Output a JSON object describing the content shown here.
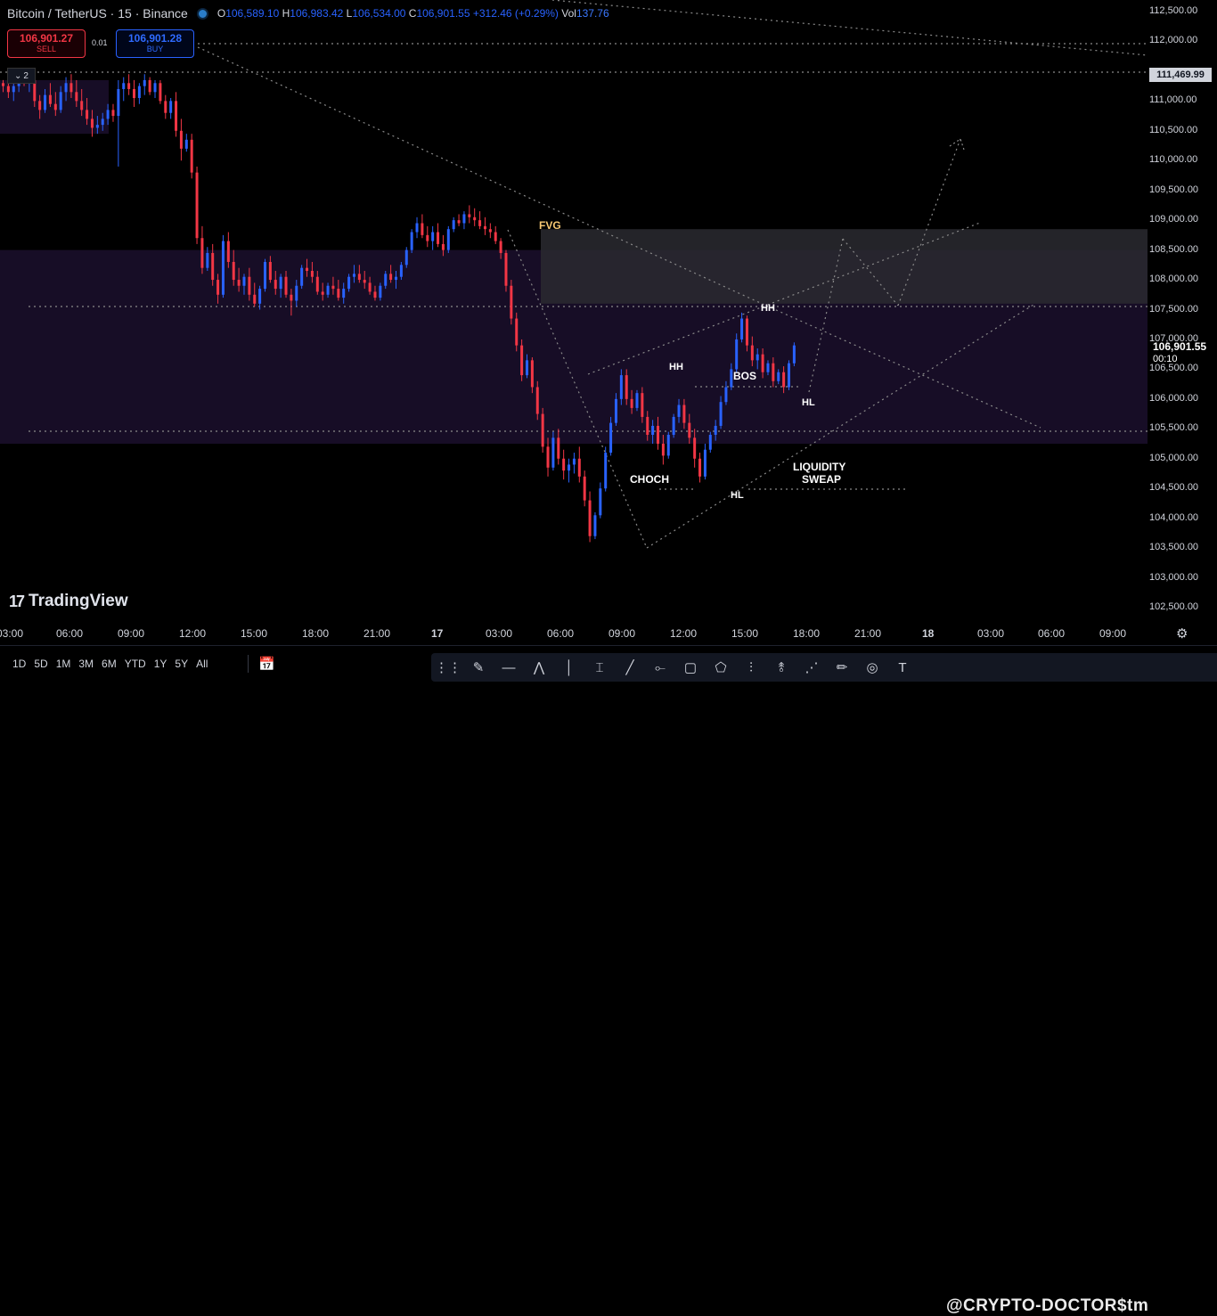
{
  "header": {
    "symbol": "Bitcoin / TetherUS · 15 · Binance",
    "open_label": "O",
    "open": "106,589.10",
    "high_label": "H",
    "high": "106,983.42",
    "low_label": "L",
    "low": "106,534.00",
    "close_label": "C",
    "close": "106,901.55",
    "change": "+312.46 (+0.29%)",
    "vol_label": "Vol",
    "vol": "137.76"
  },
  "trade": {
    "sell_price": "106,901.27",
    "sell_label": "SELL",
    "spread": "0.01",
    "buy_price": "106,901.28",
    "buy_label": "BUY"
  },
  "layers_count": "2",
  "logo": "TradingView",
  "price_axis": {
    "ticks": [
      "112,500.00",
      "112,000.00",
      "111,000.00",
      "110,500.00",
      "110,000.00",
      "109,500.00",
      "109,000.00",
      "108,500.00",
      "108,000.00",
      "107,500.00",
      "107,000.00",
      "106,500.00",
      "106,000.00",
      "105,500.00",
      "105,000.00",
      "104,500.00",
      "104,000.00",
      "103,500.00",
      "103,000.00",
      "102,500.00"
    ],
    "marked": "111,469.99",
    "current": "106,901.55",
    "countdown": "00:10"
  },
  "time_axis": [
    "03:00",
    "06:00",
    "09:00",
    "12:00",
    "15:00",
    "18:00",
    "21:00",
    "17",
    "03:00",
    "06:00",
    "09:00",
    "12:00",
    "15:00",
    "18:00",
    "21:00",
    "18",
    "03:00",
    "06:00",
    "09:00"
  ],
  "annotations": {
    "fvg": "FVG",
    "hh1": "HH",
    "hh2": "HH",
    "bos": "BOS",
    "hl1": "HL",
    "hl2": "HL",
    "choch": "CHOCH",
    "liquidity": "LIQUIDITY",
    "sweap": "SWEAP"
  },
  "ranges": [
    "1D",
    "5D",
    "1M",
    "3M",
    "6M",
    "YTD",
    "1Y",
    "5Y",
    "All"
  ],
  "watermark": "@CRYPTO-DOCTOR$tm",
  "colors": {
    "up": "#2962ff",
    "down": "#f23645",
    "zone": "#170d26",
    "fvg_zone": "#2a2a30",
    "grid_dots": "#8a8a8a"
  },
  "chart_data": {
    "type": "candlestick",
    "ylim": [
      102250,
      112750
    ],
    "series": [
      {
        "values": [
          [
            111300,
            111350,
            111150,
            111250
          ],
          [
            111250,
            111400,
            111050,
            111150
          ],
          [
            111150,
            111300,
            111000,
            111250
          ],
          [
            111250,
            111500,
            111150,
            111400
          ],
          [
            111400,
            111550,
            111250,
            111300
          ],
          [
            111300,
            111450,
            111150,
            111350
          ],
          [
            111350,
            111400,
            110900,
            111000
          ],
          [
            111000,
            111100,
            110700,
            110850
          ],
          [
            110850,
            111200,
            110800,
            111100
          ],
          [
            111100,
            111300,
            110900,
            110950
          ],
          [
            110950,
            111150,
            110750,
            110850
          ],
          [
            110850,
            111250,
            110800,
            111150
          ],
          [
            111150,
            111400,
            111000,
            111300
          ],
          [
            111300,
            111450,
            111050,
            111150
          ],
          [
            111150,
            111350,
            110900,
            111000
          ],
          [
            111000,
            111200,
            110750,
            110850
          ],
          [
            110850,
            111050,
            110600,
            110700
          ],
          [
            110700,
            110850,
            110400,
            110550
          ],
          [
            110550,
            110750,
            110450,
            110600
          ],
          [
            110600,
            110800,
            110500,
            110700
          ],
          [
            110700,
            110950,
            110600,
            110850
          ],
          [
            110850,
            110950,
            110650,
            110750
          ],
          [
            110750,
            111350,
            109900,
            111200
          ],
          [
            111200,
            111400,
            111000,
            111300
          ],
          [
            111300,
            111450,
            111100,
            111200
          ],
          [
            111200,
            111350,
            110900,
            111050
          ],
          [
            111050,
            111300,
            110950,
            111250
          ],
          [
            111250,
            111450,
            111100,
            111350
          ],
          [
            111350,
            111400,
            111100,
            111150
          ],
          [
            111150,
            111350,
            111050,
            111300
          ],
          [
            111300,
            111350,
            110950,
            111000
          ],
          [
            111000,
            111100,
            110700,
            110800
          ],
          [
            110800,
            111050,
            110700,
            111000
          ],
          [
            111000,
            111150,
            110400,
            110500
          ],
          [
            110500,
            110700,
            110000,
            110200
          ],
          [
            110200,
            110450,
            110150,
            110350
          ],
          [
            110350,
            110450,
            109700,
            109800
          ],
          [
            109800,
            109900,
            108600,
            108700
          ],
          [
            108700,
            108900,
            108100,
            108200
          ],
          [
            108200,
            108550,
            108150,
            108450
          ],
          [
            108450,
            108600,
            107900,
            108000
          ],
          [
            108000,
            108100,
            107600,
            107750
          ],
          [
            107750,
            108750,
            107700,
            108650
          ],
          [
            108650,
            108800,
            108200,
            108300
          ],
          [
            108300,
            108500,
            107900,
            108000
          ],
          [
            108000,
            108200,
            107800,
            107900
          ],
          [
            107900,
            108100,
            107750,
            108050
          ],
          [
            108050,
            108200,
            107650,
            107750
          ],
          [
            107750,
            107950,
            107550,
            107600
          ],
          [
            107600,
            107900,
            107500,
            107850
          ],
          [
            107850,
            108350,
            107800,
            108300
          ],
          [
            108300,
            108400,
            107950,
            108000
          ],
          [
            108000,
            108150,
            107750,
            107850
          ],
          [
            107850,
            108100,
            107700,
            108050
          ],
          [
            108050,
            108150,
            107700,
            107750
          ],
          [
            107750,
            107850,
            107400,
            107650
          ],
          [
            107650,
            108000,
            107550,
            107900
          ],
          [
            107900,
            108250,
            107850,
            108200
          ],
          [
            108200,
            108350,
            108050,
            108150
          ],
          [
            108150,
            108300,
            107950,
            108050
          ],
          [
            108050,
            108150,
            107750,
            107800
          ],
          [
            107800,
            107950,
            107650,
            107750
          ],
          [
            107750,
            107950,
            107700,
            107900
          ],
          [
            107900,
            108050,
            107750,
            107850
          ],
          [
            107850,
            108000,
            107650,
            107700
          ],
          [
            107700,
            107950,
            107600,
            107850
          ],
          [
            107850,
            108100,
            107800,
            108050
          ],
          [
            108050,
            108250,
            107950,
            108100
          ],
          [
            108100,
            108250,
            107950,
            108000
          ],
          [
            108000,
            108150,
            107850,
            107950
          ],
          [
            107950,
            108050,
            107750,
            107800
          ],
          [
            107800,
            107900,
            107650,
            107700
          ],
          [
            107700,
            107950,
            107650,
            107900
          ],
          [
            107900,
            108150,
            107850,
            108100
          ],
          [
            108100,
            108250,
            107950,
            108000
          ],
          [
            108000,
            108150,
            107850,
            108050
          ],
          [
            108050,
            108300,
            108000,
            108250
          ],
          [
            108250,
            108550,
            108200,
            108500
          ],
          [
            108500,
            108850,
            108450,
            108800
          ],
          [
            108800,
            109050,
            108700,
            108950
          ],
          [
            108950,
            109100,
            108700,
            108750
          ],
          [
            108750,
            108900,
            108550,
            108650
          ],
          [
            108650,
            108900,
            108500,
            108800
          ],
          [
            108800,
            108950,
            108550,
            108600
          ],
          [
            108600,
            108750,
            108400,
            108500
          ],
          [
            108500,
            108900,
            108450,
            108850
          ],
          [
            108850,
            109050,
            108800,
            109000
          ],
          [
            109000,
            109100,
            108900,
            108950
          ],
          [
            108950,
            109150,
            108850,
            109100
          ],
          [
            109100,
            109250,
            108950,
            109050
          ],
          [
            109050,
            109200,
            108900,
            109000
          ],
          [
            109000,
            109150,
            108850,
            108900
          ],
          [
            108900,
            109050,
            108750,
            108850
          ],
          [
            108850,
            108950,
            108700,
            108800
          ],
          [
            108800,
            108900,
            108600,
            108650
          ],
          [
            108650,
            108700,
            108350,
            108450
          ],
          [
            108450,
            108500,
            107800,
            107900
          ],
          [
            107900,
            108000,
            107250,
            107350
          ],
          [
            107350,
            107450,
            106800,
            106900
          ],
          [
            106900,
            107000,
            106300,
            106400
          ],
          [
            106400,
            106750,
            106350,
            106650
          ],
          [
            106650,
            106700,
            106100,
            106200
          ],
          [
            106200,
            106300,
            105650,
            105750
          ],
          [
            105750,
            105850,
            105100,
            105200
          ],
          [
            105200,
            105350,
            104700,
            104850
          ],
          [
            104850,
            105450,
            104800,
            105350
          ],
          [
            105350,
            105500,
            104900,
            105000
          ],
          [
            105000,
            105150,
            104650,
            104800
          ],
          [
            104800,
            105000,
            104600,
            104900
          ],
          [
            104900,
            105100,
            104750,
            105000
          ],
          [
            105000,
            105200,
            104600,
            104700
          ],
          [
            104700,
            104800,
            104200,
            104300
          ],
          [
            104300,
            104450,
            103600,
            103700
          ],
          [
            103700,
            104100,
            103650,
            104050
          ],
          [
            104050,
            104600,
            104000,
            104500
          ],
          [
            104500,
            105200,
            104450,
            105100
          ],
          [
            105100,
            105700,
            105050,
            105600
          ],
          [
            105600,
            106100,
            105550,
            106000
          ],
          [
            106000,
            106500,
            105900,
            106400
          ],
          [
            106400,
            106500,
            105900,
            106000
          ],
          [
            106000,
            106150,
            105750,
            105850
          ],
          [
            105850,
            106150,
            105800,
            106100
          ],
          [
            106100,
            106200,
            105600,
            105700
          ],
          [
            105700,
            105800,
            105300,
            105400
          ],
          [
            105400,
            105650,
            105250,
            105550
          ],
          [
            105550,
            105700,
            105150,
            105250
          ],
          [
            105250,
            105400,
            104900,
            105050
          ],
          [
            105050,
            105450,
            105000,
            105400
          ],
          [
            105400,
            105750,
            105350,
            105700
          ],
          [
            105700,
            106000,
            105600,
            105900
          ],
          [
            105900,
            106000,
            105500,
            105600
          ],
          [
            105600,
            105750,
            105250,
            105350
          ],
          [
            105350,
            105500,
            104850,
            105000
          ],
          [
            105000,
            105100,
            104600,
            104700
          ],
          [
            104700,
            105250,
            104650,
            105150
          ],
          [
            105150,
            105450,
            105100,
            105400
          ],
          [
            105400,
            105650,
            105300,
            105550
          ],
          [
            105550,
            106050,
            105500,
            105950
          ],
          [
            105950,
            106300,
            105900,
            106200
          ],
          [
            106200,
            106600,
            106150,
            106500
          ],
          [
            106500,
            107100,
            106450,
            107000
          ],
          [
            107000,
            107450,
            106950,
            107350
          ],
          [
            107350,
            107400,
            106800,
            106900
          ],
          [
            106900,
            107050,
            106550,
            106650
          ],
          [
            106650,
            106850,
            106500,
            106750
          ],
          [
            106750,
            106850,
            106350,
            106450
          ],
          [
            106450,
            106650,
            106400,
            106600
          ],
          [
            106600,
            106700,
            106200,
            106300
          ],
          [
            106300,
            106500,
            106250,
            106450
          ],
          [
            106450,
            106550,
            106100,
            106200
          ],
          [
            106200,
            106650,
            106150,
            106600
          ],
          [
            106600,
            106950,
            106550,
            106900
          ]
        ]
      }
    ]
  }
}
